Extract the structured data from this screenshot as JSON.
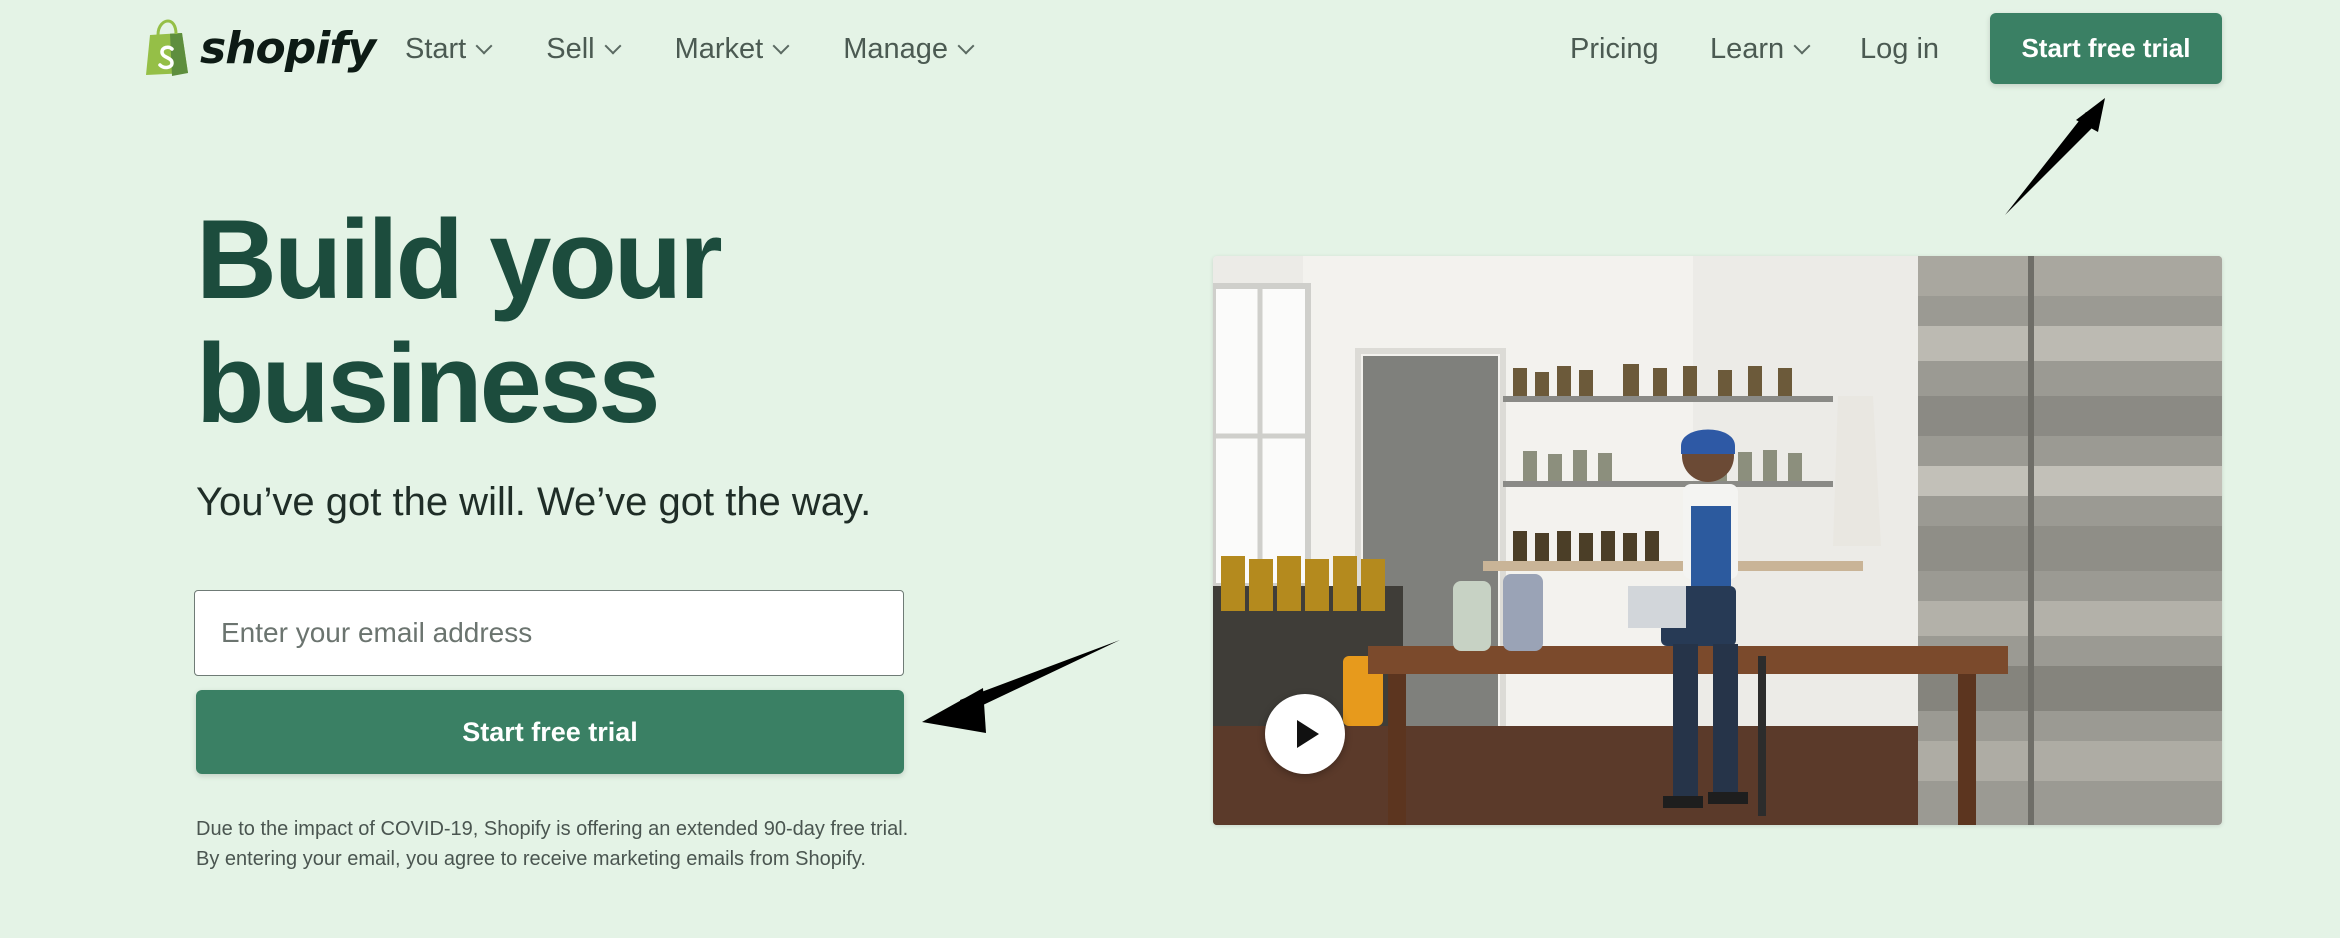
{
  "brand": {
    "name": "shopify",
    "logo_icon": "shopping-bag-logo",
    "accent": "#3a8064",
    "background": "#e4f3e6",
    "heading_color": "#1c4c3d"
  },
  "nav": {
    "left": [
      {
        "label": "Start",
        "icon": "chevron-down-icon"
      },
      {
        "label": "Sell",
        "icon": "chevron-down-icon"
      },
      {
        "label": "Market",
        "icon": "chevron-down-icon"
      },
      {
        "label": "Manage",
        "icon": "chevron-down-icon"
      }
    ],
    "pricing": "Pricing",
    "learn": "Learn",
    "login": "Log in",
    "cta": "Start free trial"
  },
  "hero": {
    "title_line1": "Build your",
    "title_line2": "business",
    "subtitle": "You’ve got the will. We’ve got the way.",
    "email_placeholder": "Enter your email address",
    "email_value": "",
    "cta": "Start free trial",
    "disclaimer_line1": "Due to the impact of COVID-19, Shopify is offering an extended 90-day free trial.",
    "disclaimer_line2": "By entering your email, you agree to receive marketing emails from Shopify.",
    "video_icon": "play-icon"
  }
}
